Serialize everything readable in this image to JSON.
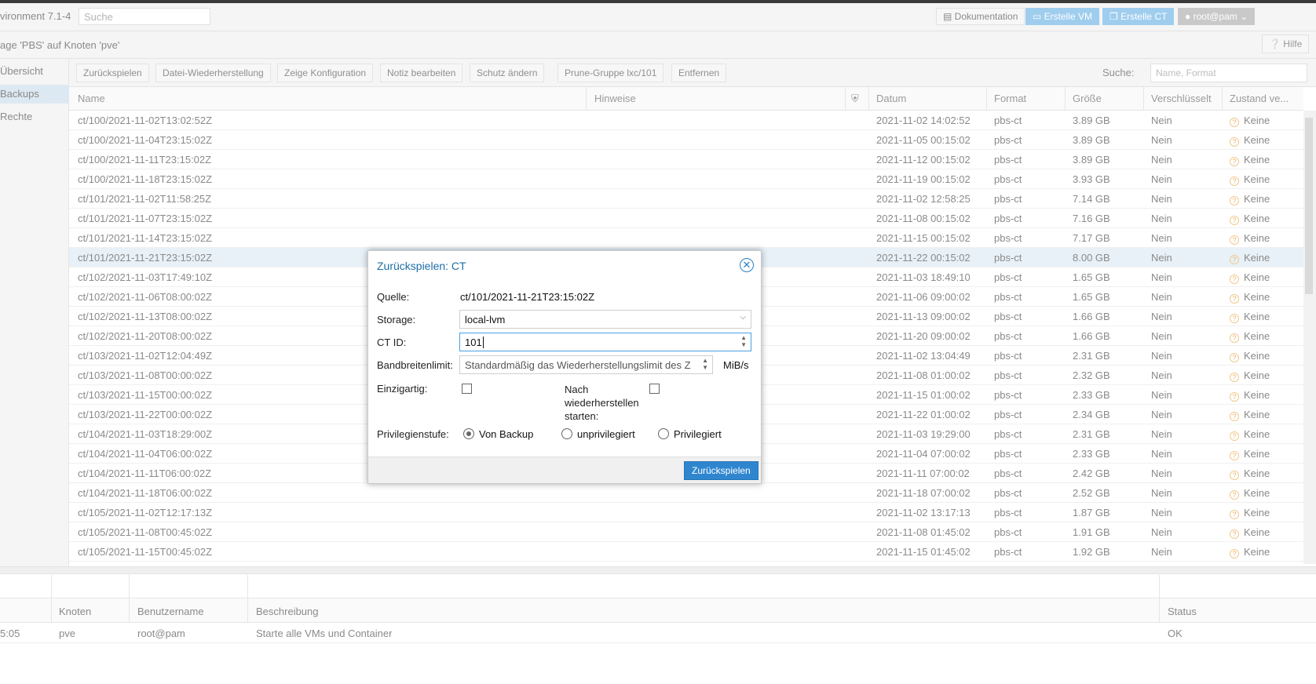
{
  "header": {
    "env_title": "vironment 7.1-4",
    "search_placeholder": "Suche",
    "doc_button": "Dokumentation",
    "create_vm_button": "Erstelle VM",
    "create_ct_button": "Erstelle CT",
    "user_button": "root@pam"
  },
  "titlebar": {
    "title": "age 'PBS' auf Knoten 'pve'",
    "help_button": "Hilfe"
  },
  "sidebar": {
    "items": [
      {
        "label": "Übersicht"
      },
      {
        "label": "Backups"
      },
      {
        "label": "Rechte"
      }
    ]
  },
  "toolbar": {
    "buttons": [
      "Zurückspielen",
      "Datei-Wiederherstellung",
      "Zeige Konfiguration",
      "Notiz bearbeiten",
      "Schutz ändern",
      "Prune-Gruppe lxc/101",
      "Entfernen"
    ],
    "search_label": "Suche:",
    "search_placeholder": "Name, Format"
  },
  "grid": {
    "columns": [
      "Name",
      "Hinweise",
      "Datum",
      "Format",
      "Größe",
      "Verschlüsselt",
      "Zustand ve..."
    ],
    "rows": [
      {
        "name": "ct/100/2021-11-02T13:02:52Z",
        "date": "2021-11-02 14:02:52",
        "format": "pbs-ct",
        "size": "3.89 GB",
        "enc": "Nein",
        "state": "Keine"
      },
      {
        "name": "ct/100/2021-11-04T23:15:02Z",
        "date": "2021-11-05 00:15:02",
        "format": "pbs-ct",
        "size": "3.89 GB",
        "enc": "Nein",
        "state": "Keine"
      },
      {
        "name": "ct/100/2021-11-11T23:15:02Z",
        "date": "2021-11-12 00:15:02",
        "format": "pbs-ct",
        "size": "3.89 GB",
        "enc": "Nein",
        "state": "Keine"
      },
      {
        "name": "ct/100/2021-11-18T23:15:02Z",
        "date": "2021-11-19 00:15:02",
        "format": "pbs-ct",
        "size": "3.93 GB",
        "enc": "Nein",
        "state": "Keine"
      },
      {
        "name": "ct/101/2021-11-02T11:58:25Z",
        "date": "2021-11-02 12:58:25",
        "format": "pbs-ct",
        "size": "7.14 GB",
        "enc": "Nein",
        "state": "Keine"
      },
      {
        "name": "ct/101/2021-11-07T23:15:02Z",
        "date": "2021-11-08 00:15:02",
        "format": "pbs-ct",
        "size": "7.16 GB",
        "enc": "Nein",
        "state": "Keine"
      },
      {
        "name": "ct/101/2021-11-14T23:15:02Z",
        "date": "2021-11-15 00:15:02",
        "format": "pbs-ct",
        "size": "7.17 GB",
        "enc": "Nein",
        "state": "Keine"
      },
      {
        "name": "ct/101/2021-11-21T23:15:02Z",
        "date": "2021-11-22 00:15:02",
        "format": "pbs-ct",
        "size": "8.00 GB",
        "enc": "Nein",
        "state": "Keine"
      },
      {
        "name": "ct/102/2021-11-03T17:49:10Z",
        "date": "2021-11-03 18:49:10",
        "format": "pbs-ct",
        "size": "1.65 GB",
        "enc": "Nein",
        "state": "Keine"
      },
      {
        "name": "ct/102/2021-11-06T08:00:02Z",
        "date": "2021-11-06 09:00:02",
        "format": "pbs-ct",
        "size": "1.65 GB",
        "enc": "Nein",
        "state": "Keine"
      },
      {
        "name": "ct/102/2021-11-13T08:00:02Z",
        "date": "2021-11-13 09:00:02",
        "format": "pbs-ct",
        "size": "1.66 GB",
        "enc": "Nein",
        "state": "Keine"
      },
      {
        "name": "ct/102/2021-11-20T08:00:02Z",
        "date": "2021-11-20 09:00:02",
        "format": "pbs-ct",
        "size": "1.66 GB",
        "enc": "Nein",
        "state": "Keine"
      },
      {
        "name": "ct/103/2021-11-02T12:04:49Z",
        "date": "2021-11-02 13:04:49",
        "format": "pbs-ct",
        "size": "2.31 GB",
        "enc": "Nein",
        "state": "Keine"
      },
      {
        "name": "ct/103/2021-11-08T00:00:02Z",
        "date": "2021-11-08 01:00:02",
        "format": "pbs-ct",
        "size": "2.32 GB",
        "enc": "Nein",
        "state": "Keine"
      },
      {
        "name": "ct/103/2021-11-15T00:00:02Z",
        "date": "2021-11-15 01:00:02",
        "format": "pbs-ct",
        "size": "2.33 GB",
        "enc": "Nein",
        "state": "Keine"
      },
      {
        "name": "ct/103/2021-11-22T00:00:02Z",
        "date": "2021-11-22 01:00:02",
        "format": "pbs-ct",
        "size": "2.34 GB",
        "enc": "Nein",
        "state": "Keine"
      },
      {
        "name": "ct/104/2021-11-03T18:29:00Z",
        "date": "2021-11-03 19:29:00",
        "format": "pbs-ct",
        "size": "2.31 GB",
        "enc": "Nein",
        "state": "Keine"
      },
      {
        "name": "ct/104/2021-11-04T06:00:02Z",
        "date": "2021-11-04 07:00:02",
        "format": "pbs-ct",
        "size": "2.33 GB",
        "enc": "Nein",
        "state": "Keine"
      },
      {
        "name": "ct/104/2021-11-11T06:00:02Z",
        "date": "2021-11-11 07:00:02",
        "format": "pbs-ct",
        "size": "2.42 GB",
        "enc": "Nein",
        "state": "Keine"
      },
      {
        "name": "ct/104/2021-11-18T06:00:02Z",
        "date": "2021-11-18 07:00:02",
        "format": "pbs-ct",
        "size": "2.52 GB",
        "enc": "Nein",
        "state": "Keine"
      },
      {
        "name": "ct/105/2021-11-02T12:17:13Z",
        "date": "2021-11-02 13:17:13",
        "format": "pbs-ct",
        "size": "1.87 GB",
        "enc": "Nein",
        "state": "Keine"
      },
      {
        "name": "ct/105/2021-11-08T00:45:02Z",
        "date": "2021-11-08 01:45:02",
        "format": "pbs-ct",
        "size": "1.91 GB",
        "enc": "Nein",
        "state": "Keine"
      },
      {
        "name": "ct/105/2021-11-15T00:45:02Z",
        "date": "2021-11-15 01:45:02",
        "format": "pbs-ct",
        "size": "1.92 GB",
        "enc": "Nein",
        "state": "Keine"
      }
    ],
    "selected_index": 7
  },
  "log": {
    "columns": [
      "Knoten",
      "Benutzername",
      "Beschreibung",
      "Status"
    ],
    "row": {
      "time": "5:05",
      "node": "pve",
      "user": "root@pam",
      "desc": "Starte alle VMs und Container",
      "status": "OK"
    }
  },
  "dialog": {
    "title": "Zurückspielen: CT",
    "source_label": "Quelle:",
    "source_value": "ct/101/2021-11-21T23:15:02Z",
    "storage_label": "Storage:",
    "storage_value": "local-lvm",
    "ctid_label": "CT ID:",
    "ctid_value": "101",
    "bw_label": "Bandbreitenlimit:",
    "bw_placeholder": "Standardmäßig das Wiederherstellungslimit des Z",
    "bw_unit": "MiB/s",
    "unique_label": "Einzigartig:",
    "start_label": "Nach wiederherstellen starten:",
    "priv_label": "Privilegienstufe:",
    "priv_options": [
      "Von Backup",
      "unprivilegiert",
      "Privilegiert"
    ],
    "priv_selected": "Von Backup",
    "submit_button": "Zurückspielen"
  }
}
